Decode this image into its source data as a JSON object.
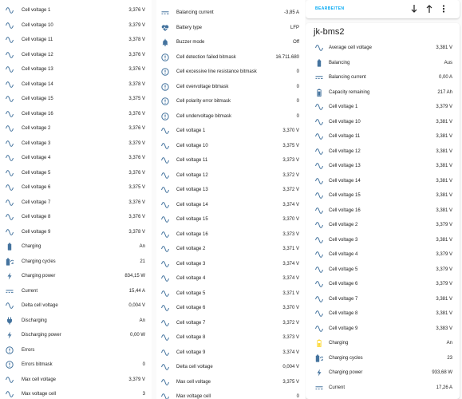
{
  "colors": {
    "icon": "#44739e",
    "accent": "#03a9f4",
    "charging_icon": "#fdd835"
  },
  "col1": [
    {
      "icon": "sine-wave-icon",
      "label": "Cell voltage 1",
      "value": "3,376 V"
    },
    {
      "icon": "sine-wave-icon",
      "label": "Cell voltage 10",
      "value": "3,379 V"
    },
    {
      "icon": "sine-wave-icon",
      "label": "Cell voltage 11",
      "value": "3,378 V"
    },
    {
      "icon": "sine-wave-icon",
      "label": "Cell voltage 12",
      "value": "3,376 V"
    },
    {
      "icon": "sine-wave-icon",
      "label": "Cell voltage 13",
      "value": "3,376 V"
    },
    {
      "icon": "sine-wave-icon",
      "label": "Cell voltage 14",
      "value": "3,378 V"
    },
    {
      "icon": "sine-wave-icon",
      "label": "Cell voltage 15",
      "value": "3,375 V"
    },
    {
      "icon": "sine-wave-icon",
      "label": "Cell voltage 16",
      "value": "3,376 V"
    },
    {
      "icon": "sine-wave-icon",
      "label": "Cell voltage 2",
      "value": "3,376 V"
    },
    {
      "icon": "sine-wave-icon",
      "label": "Cell voltage 3",
      "value": "3,379 V"
    },
    {
      "icon": "sine-wave-icon",
      "label": "Cell voltage 4",
      "value": "3,376 V"
    },
    {
      "icon": "sine-wave-icon",
      "label": "Cell voltage 5",
      "value": "3,376 V"
    },
    {
      "icon": "sine-wave-icon",
      "label": "Cell voltage 6",
      "value": "3,375 V"
    },
    {
      "icon": "sine-wave-icon",
      "label": "Cell voltage 7",
      "value": "3,376 V"
    },
    {
      "icon": "sine-wave-icon",
      "label": "Cell voltage 8",
      "value": "3,376 V"
    },
    {
      "icon": "sine-wave-icon",
      "label": "Cell voltage 9",
      "value": "3,378 V"
    },
    {
      "icon": "battery-icon",
      "label": "Charging",
      "value": "An"
    },
    {
      "icon": "battery-sync-icon",
      "label": "Charging cycles",
      "value": "21"
    },
    {
      "icon": "flash-icon",
      "label": "Charging power",
      "value": "834,15 W"
    },
    {
      "icon": "current-dc-icon",
      "label": "Current",
      "value": "15,44 A"
    },
    {
      "icon": "sine-wave-icon",
      "label": "Delta cell voltage",
      "value": "0,004 V"
    },
    {
      "icon": "plug-icon",
      "label": "Discharging",
      "value": "An"
    },
    {
      "icon": "flash-icon",
      "label": "Discharging power",
      "value": "0,00 W"
    },
    {
      "icon": "alert-circle-icon",
      "label": "Errors",
      "value": ""
    },
    {
      "icon": "alert-circle-icon",
      "label": "Errors bitmask",
      "value": "0"
    },
    {
      "icon": "sine-wave-icon",
      "label": "Max cell voltage",
      "value": "3,379 V"
    },
    {
      "icon": "sine-wave-icon",
      "label": "Max voltage cell",
      "value": "3"
    }
  ],
  "col2": [
    {
      "icon": "current-dc-icon",
      "label": "Balancing current",
      "value": "-3,85 A"
    },
    {
      "icon": "heart-pulse-icon",
      "label": "Battery type",
      "value": "LFP"
    },
    {
      "icon": "bell-icon",
      "label": "Buzzer mode",
      "value": "Off"
    },
    {
      "icon": "alert-circle-icon",
      "label": "Cell detection failed bitmask",
      "value": "16.711.680"
    },
    {
      "icon": "alert-circle-icon",
      "label": "Cell excessive line resistance bitmask",
      "value": "0"
    },
    {
      "icon": "alert-circle-icon",
      "label": "Cell overvoltage bitmask",
      "value": "0"
    },
    {
      "icon": "alert-circle-icon",
      "label": "Cell polarity error bitmask",
      "value": "0"
    },
    {
      "icon": "alert-circle-icon",
      "label": "Cell undervoltage bitmask",
      "value": "0"
    },
    {
      "icon": "sine-wave-icon",
      "label": "Cell voltage 1",
      "value": "3,370 V"
    },
    {
      "icon": "sine-wave-icon",
      "label": "Cell voltage 10",
      "value": "3,375 V"
    },
    {
      "icon": "sine-wave-icon",
      "label": "Cell voltage 11",
      "value": "3,373 V"
    },
    {
      "icon": "sine-wave-icon",
      "label": "Cell voltage 12",
      "value": "3,372 V"
    },
    {
      "icon": "sine-wave-icon",
      "label": "Cell voltage 13",
      "value": "3,372 V"
    },
    {
      "icon": "sine-wave-icon",
      "label": "Cell voltage 14",
      "value": "3,374 V"
    },
    {
      "icon": "sine-wave-icon",
      "label": "Cell voltage 15",
      "value": "3,370 V"
    },
    {
      "icon": "sine-wave-icon",
      "label": "Cell voltage 16",
      "value": "3,373 V"
    },
    {
      "icon": "sine-wave-icon",
      "label": "Cell voltage 2",
      "value": "3,371 V"
    },
    {
      "icon": "sine-wave-icon",
      "label": "Cell voltage 3",
      "value": "3,374 V"
    },
    {
      "icon": "sine-wave-icon",
      "label": "Cell voltage 4",
      "value": "3,374 V"
    },
    {
      "icon": "sine-wave-icon",
      "label": "Cell voltage 5",
      "value": "3,371 V"
    },
    {
      "icon": "sine-wave-icon",
      "label": "Cell voltage 6",
      "value": "3,370 V"
    },
    {
      "icon": "sine-wave-icon",
      "label": "Cell voltage 7",
      "value": "3,372 V"
    },
    {
      "icon": "sine-wave-icon",
      "label": "Cell voltage 8",
      "value": "3,373 V"
    },
    {
      "icon": "sine-wave-icon",
      "label": "Cell voltage 9",
      "value": "3,374 V"
    },
    {
      "icon": "sine-wave-icon",
      "label": "Delta cell voltage",
      "value": "0,004 V"
    },
    {
      "icon": "sine-wave-icon",
      "label": "Max cell voltage",
      "value": "3,375 V"
    },
    {
      "icon": "sine-wave-icon",
      "label": "Max voltage cell",
      "value": "0"
    }
  ],
  "toolbar": {
    "edit_label": "BEARBEITEN"
  },
  "card": {
    "title": "jk-bms2",
    "rows": [
      {
        "icon": "sine-wave-icon",
        "label": "Average cell voltage",
        "value": "3,381 V"
      },
      {
        "icon": "battery-icon",
        "label": "Balancing",
        "value": "Aus"
      },
      {
        "icon": "current-dc-icon",
        "label": "Balancing current",
        "value": "0,00 A"
      },
      {
        "icon": "battery-level-icon",
        "label": "Capacity remaining",
        "value": "217 Ah"
      },
      {
        "icon": "sine-wave-icon",
        "label": "Cell voltage 1",
        "value": "3,379 V"
      },
      {
        "icon": "sine-wave-icon",
        "label": "Cell voltage 10",
        "value": "3,381 V"
      },
      {
        "icon": "sine-wave-icon",
        "label": "Cell voltage 11",
        "value": "3,381 V"
      },
      {
        "icon": "sine-wave-icon",
        "label": "Cell voltage 12",
        "value": "3,381 V"
      },
      {
        "icon": "sine-wave-icon",
        "label": "Cell voltage 13",
        "value": "3,381 V"
      },
      {
        "icon": "sine-wave-icon",
        "label": "Cell voltage 14",
        "value": "3,381 V"
      },
      {
        "icon": "sine-wave-icon",
        "label": "Cell voltage 15",
        "value": "3,381 V"
      },
      {
        "icon": "sine-wave-icon",
        "label": "Cell voltage 16",
        "value": "3,381 V"
      },
      {
        "icon": "sine-wave-icon",
        "label": "Cell voltage 2",
        "value": "3,379 V"
      },
      {
        "icon": "sine-wave-icon",
        "label": "Cell voltage 3",
        "value": "3,381 V"
      },
      {
        "icon": "sine-wave-icon",
        "label": "Cell voltage 4",
        "value": "3,379 V"
      },
      {
        "icon": "sine-wave-icon",
        "label": "Cell voltage 5",
        "value": "3,379 V"
      },
      {
        "icon": "sine-wave-icon",
        "label": "Cell voltage 6",
        "value": "3,379 V"
      },
      {
        "icon": "sine-wave-icon",
        "label": "Cell voltage 7",
        "value": "3,381 V"
      },
      {
        "icon": "sine-wave-icon",
        "label": "Cell voltage 8",
        "value": "3,381 V"
      },
      {
        "icon": "sine-wave-icon",
        "label": "Cell voltage 9",
        "value": "3,383 V"
      },
      {
        "icon": "battery-charging-icon",
        "label": "Charging",
        "value": "An"
      },
      {
        "icon": "battery-sync-icon",
        "label": "Charging cycles",
        "value": "23"
      },
      {
        "icon": "flash-icon",
        "label": "Charging power",
        "value": "933,68 W"
      },
      {
        "icon": "current-dc-icon",
        "label": "Current",
        "value": "17,26 A"
      }
    ]
  }
}
